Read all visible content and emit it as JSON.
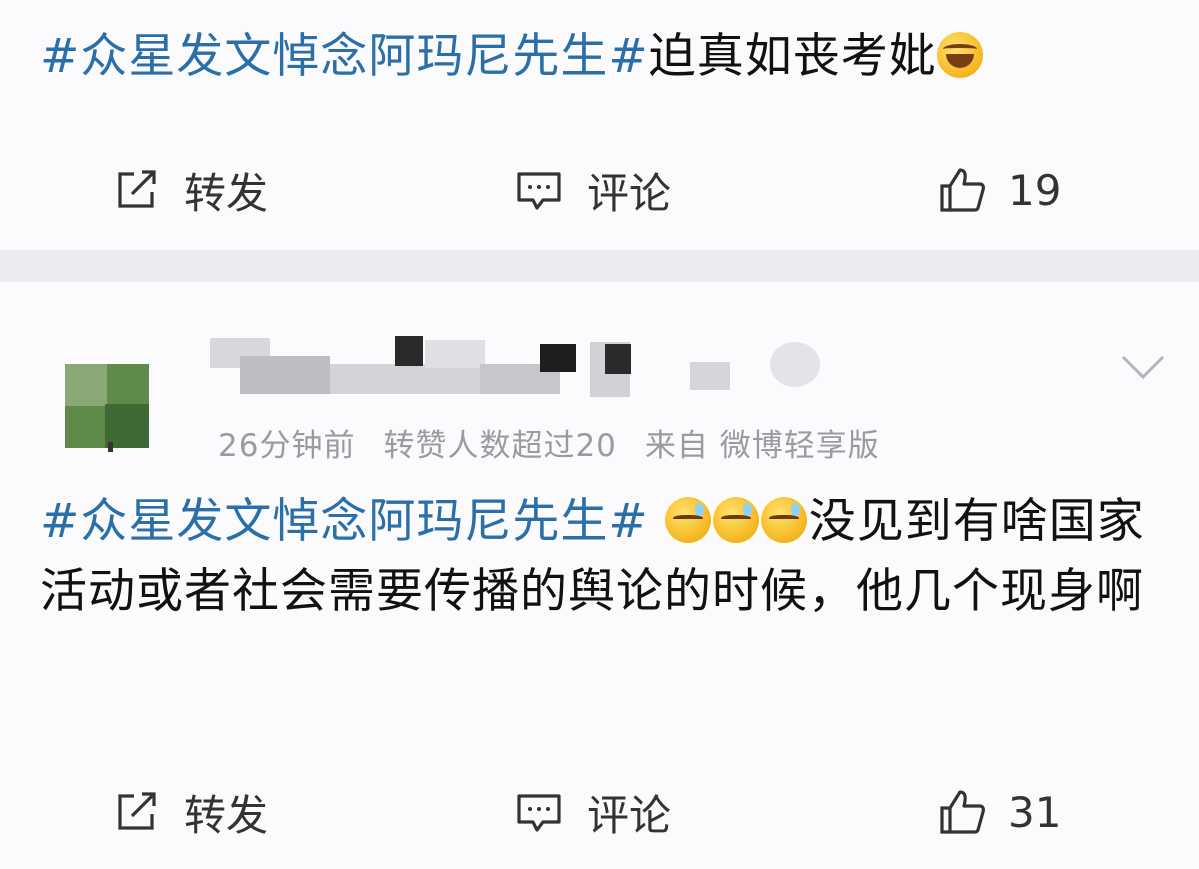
{
  "post1": {
    "tag": "#众星发文悼念阿玛尼先生#",
    "text": "迫真如丧考妣",
    "emoji": "rolling-on-floor-laughing",
    "actions": {
      "repost": "转发",
      "comment": "评论",
      "likes": "19"
    }
  },
  "post2": {
    "meta": {
      "time": "26分钟前",
      "repost_note": "转赞人数超过20",
      "source": "来自 微博轻享版"
    },
    "tag": "#众星发文悼念阿玛尼先生#",
    "emojis": [
      "sweat-smile",
      "sweat-smile",
      "sweat-smile"
    ],
    "text": "没见到有啥国家活动或者社会需要传播的舆论的时候，他几个现身啊",
    "actions": {
      "repost": "转发",
      "comment": "评论",
      "likes": "31"
    }
  }
}
